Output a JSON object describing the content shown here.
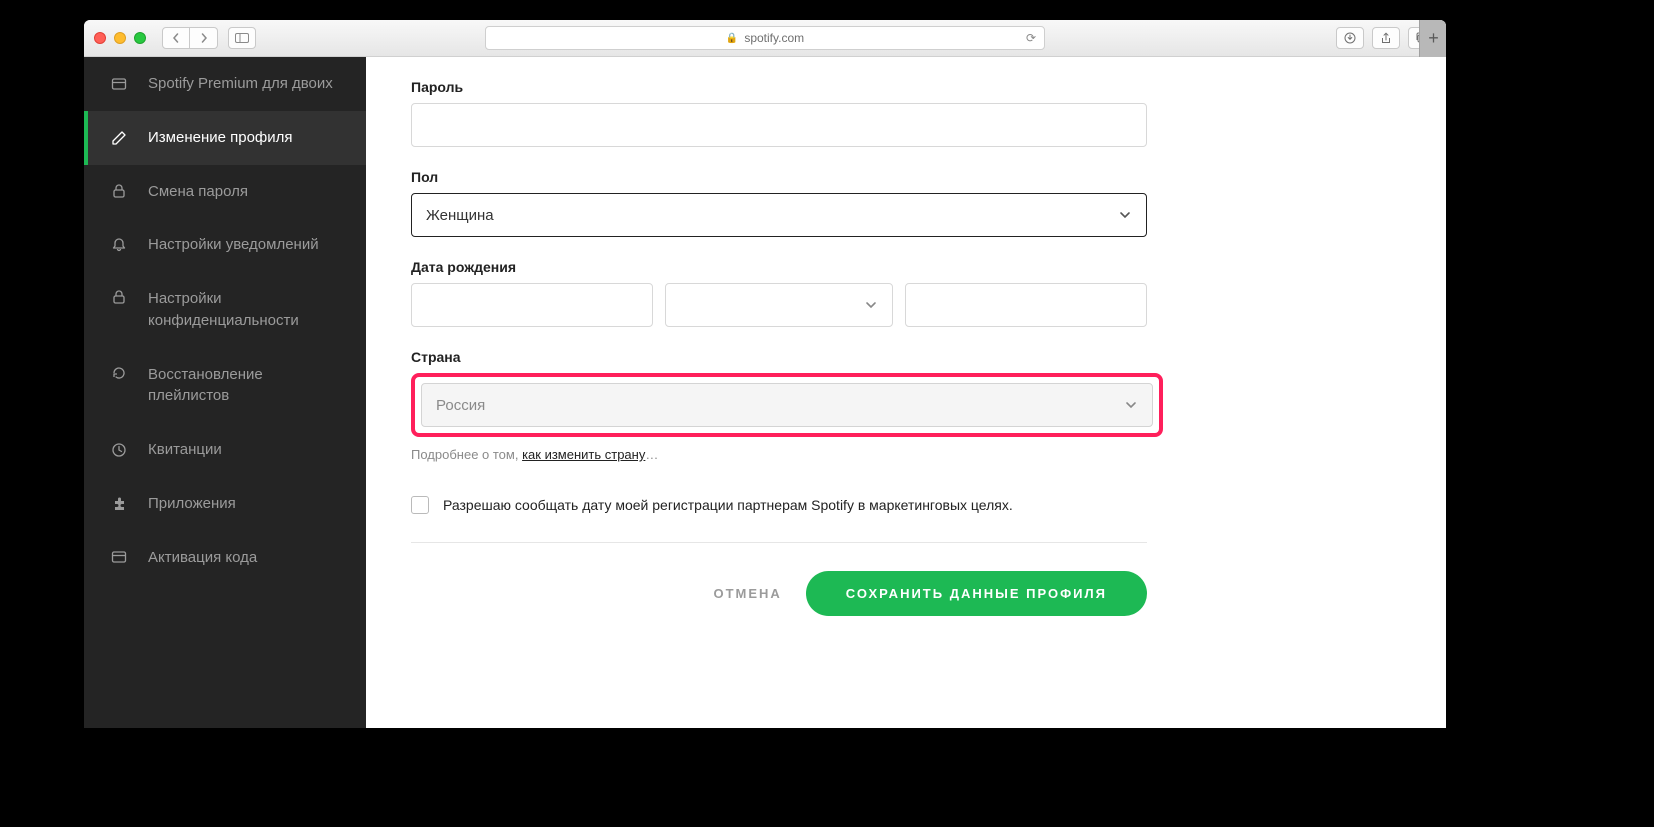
{
  "browser": {
    "url_host": "spotify.com"
  },
  "sidebar": {
    "items": [
      {
        "icon": "card",
        "label": "Spotify Premium для двоих"
      },
      {
        "icon": "pencil",
        "label": "Изменение профиля",
        "active": true
      },
      {
        "icon": "lock",
        "label": "Смена пароля"
      },
      {
        "icon": "bell",
        "label": "Настройки уведомлений"
      },
      {
        "icon": "lock",
        "label": "Настройки конфиденциальности"
      },
      {
        "icon": "restore",
        "label": "Восстановление плейлистов"
      },
      {
        "icon": "clock",
        "label": "Квитанции"
      },
      {
        "icon": "puzzle",
        "label": "Приложения"
      },
      {
        "icon": "card",
        "label": "Активация кода"
      }
    ]
  },
  "form": {
    "password_label": "Пароль",
    "gender_label": "Пол",
    "gender_value": "Женщина",
    "dob_label": "Дата рождения",
    "country_label": "Страна",
    "country_value": "Россия",
    "country_hint_prefix": "Подробнее о том, ",
    "country_hint_link": "как изменить страну",
    "country_hint_suffix": "…",
    "consent_text": "Разрешаю сообщать дату моей регистрации партнерам Spotify в маркетинговых целях.",
    "cancel": "ОТМЕНА",
    "save": "СОХРАНИТЬ ДАННЫЕ ПРОФИЛЯ"
  }
}
